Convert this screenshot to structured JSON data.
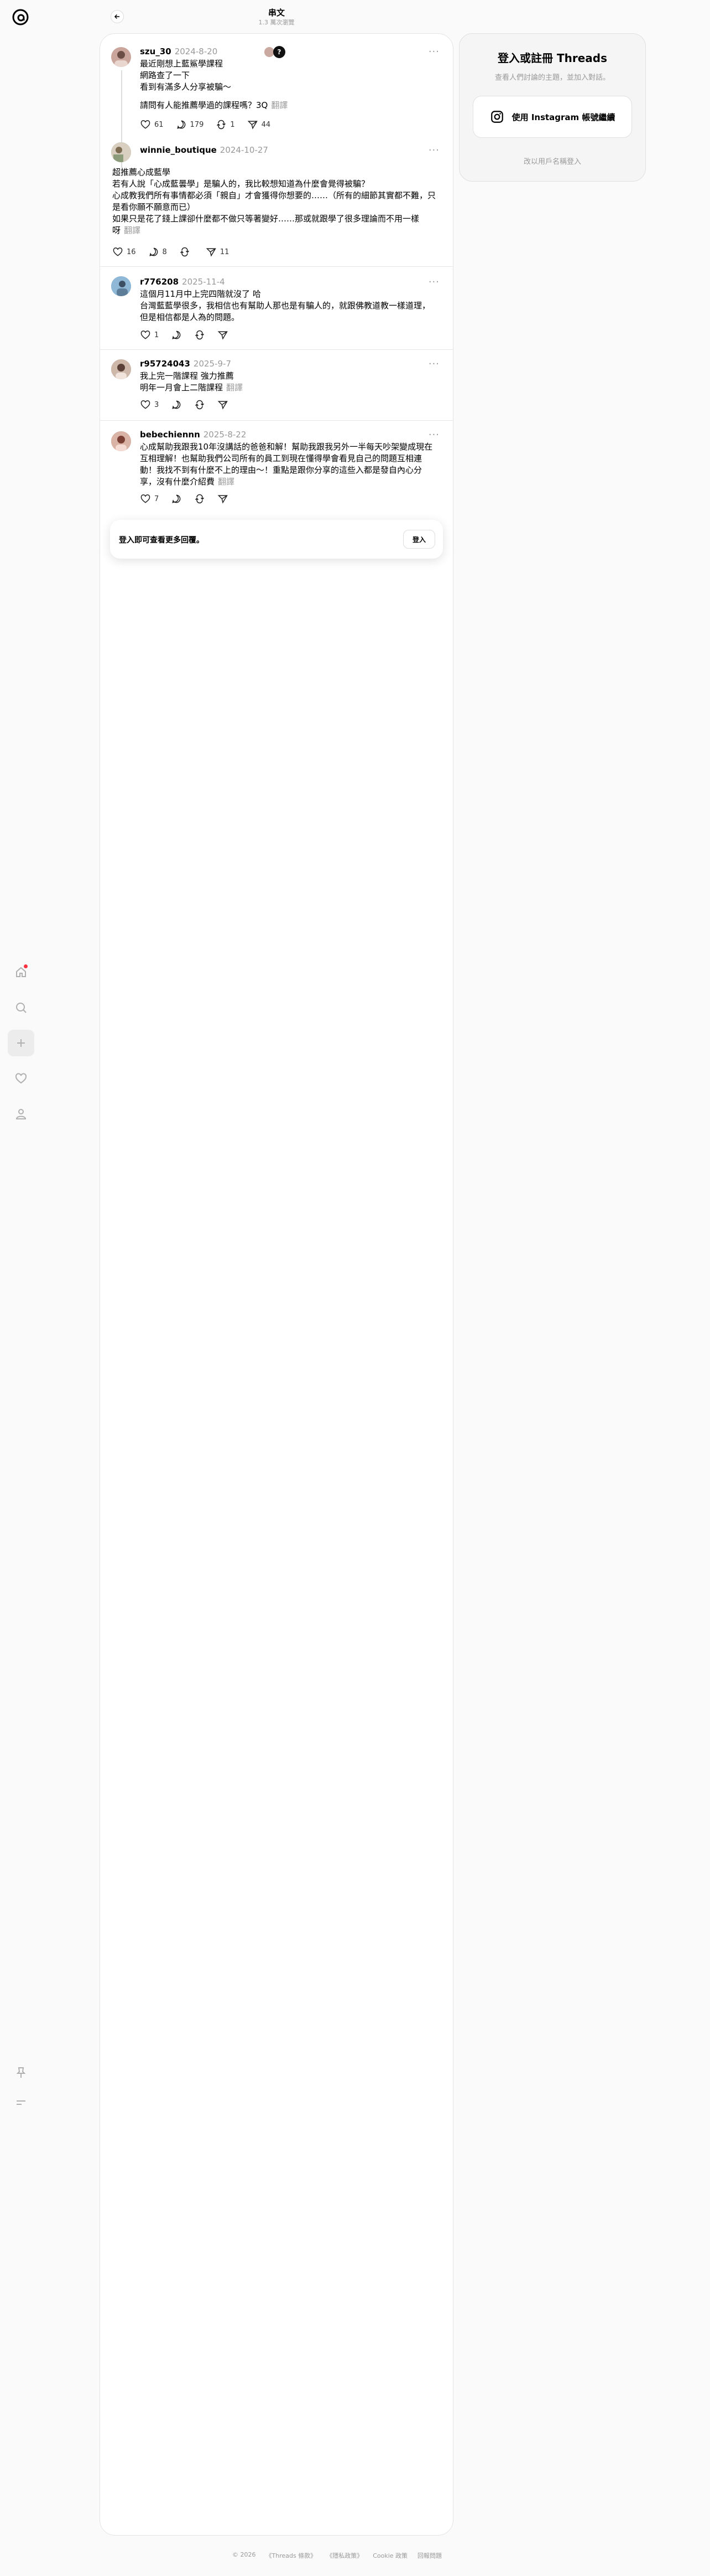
{
  "header": {
    "title": "串文",
    "subtitle": "1.3 萬次瀏覽"
  },
  "rail": {
    "icons": [
      "threads-logo-icon",
      "home-icon",
      "search-icon",
      "plus-icon",
      "heart-icon",
      "profile-icon",
      "pin-icon",
      "menu-icon"
    ]
  },
  "posts": [
    {
      "user": "szu_30",
      "date": "2024-8-20",
      "lines": [
        "最近剛想上藍鯊學課程",
        "網路查了一下",
        "看到有滿多人分享被騙～"
      ],
      "extra": "請問有人能推薦學過的課程嗎？3Q",
      "translate": "翻譯",
      "likes": "61",
      "replies": "179",
      "reposts": "1",
      "shares": "44"
    },
    {
      "user": "winnie_boutique",
      "date": "2024-10-27",
      "lines": [
        "超推薦心成藍學",
        "若有人說「心成藍曇學」是騙人的，我比較想知道為什麼會覺得被騙？",
        "心成教我們所有事情都必須「親自」才會獲得你想要的……（所有的細節其實都不難，只是看你願不願意而已）",
        "如果只是花了錢上課卻什麼都不做只等著變好……那或就跟學了很多理論而不用一樣"
      ],
      "tail": "呀",
      "translate": "翻譯",
      "likes": "16",
      "replies": "8",
      "reposts": "",
      "shares": "11"
    },
    {
      "user": "r776208",
      "date": "2025-11-4",
      "lines": [
        "這個月11月中上完四階就沒了 哈",
        "台灣藍藍學很多，我相信也有幫助人那也是有騙人的，就跟佛教道教一樣道理，但是相信都是人為的問題。"
      ],
      "likes": "1",
      "replies": "",
      "reposts": "",
      "shares": ""
    },
    {
      "user": "r95724043",
      "date": "2025-9-7",
      "lines": [
        "我上完一階課程 強力推薦"
      ],
      "last": "明年一月會上二階課程",
      "translate": "翻譯",
      "likes": "3",
      "replies": "",
      "reposts": "",
      "shares": ""
    },
    {
      "user": "bebechiennn",
      "date": "2025-8-22",
      "lines": [
        "心成幫助我跟我10年沒講話的爸爸和解！幫助我跟我另外一半每天吵架變成現在互相理解！也幫助我們公司所有的員工到現在懂得學會看見自己的問題互相連動！我找不到有什麼不上的理由～！重點是跟你分享的這些入都是發自內心分享，沒有什麼介紹費"
      ],
      "translate": "翻譯",
      "likes": "7",
      "replies": "",
      "reposts": "",
      "shares": ""
    }
  ],
  "login_banner": {
    "text": "登入即可查看更多回覆。",
    "button": "登入"
  },
  "panel": {
    "title": "登入或註冊 Threads",
    "subtitle": "查看人們討論的主題，並加入對話。",
    "button": "使用 Instagram 帳號繼續",
    "alt": "改以用戶名稱登入"
  },
  "footer": [
    "© 2026",
    "《Threads 條款》",
    "《隱私政策》",
    "Cookie 政策",
    "回報問題"
  ]
}
